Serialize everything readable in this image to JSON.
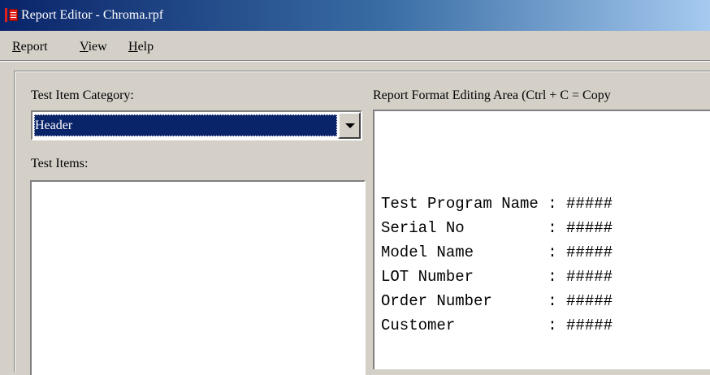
{
  "window": {
    "title": "Report Editor - Chroma.rpf"
  },
  "menu": [
    {
      "accel": "R",
      "rest": "eport"
    },
    {
      "accel": "V",
      "rest": "iew"
    },
    {
      "accel": "H",
      "rest": "elp"
    }
  ],
  "left_panel": {
    "category_label": "Test Item Category:",
    "category_value": "Header",
    "items_label": "Test Items:"
  },
  "right_panel": {
    "editing_label": "Report Format Editing Area (Ctrl + C = Copy",
    "report_lines": [
      "Test Program Name : #####",
      "Serial No         : #####",
      "Model Name        : #####",
      "LOT Number        : #####",
      "Order Number      : #####",
      "Customer          : #####"
    ]
  },
  "icons": {
    "app": "report-editor-app-icon",
    "dropdown": "chevron-down-icon"
  }
}
